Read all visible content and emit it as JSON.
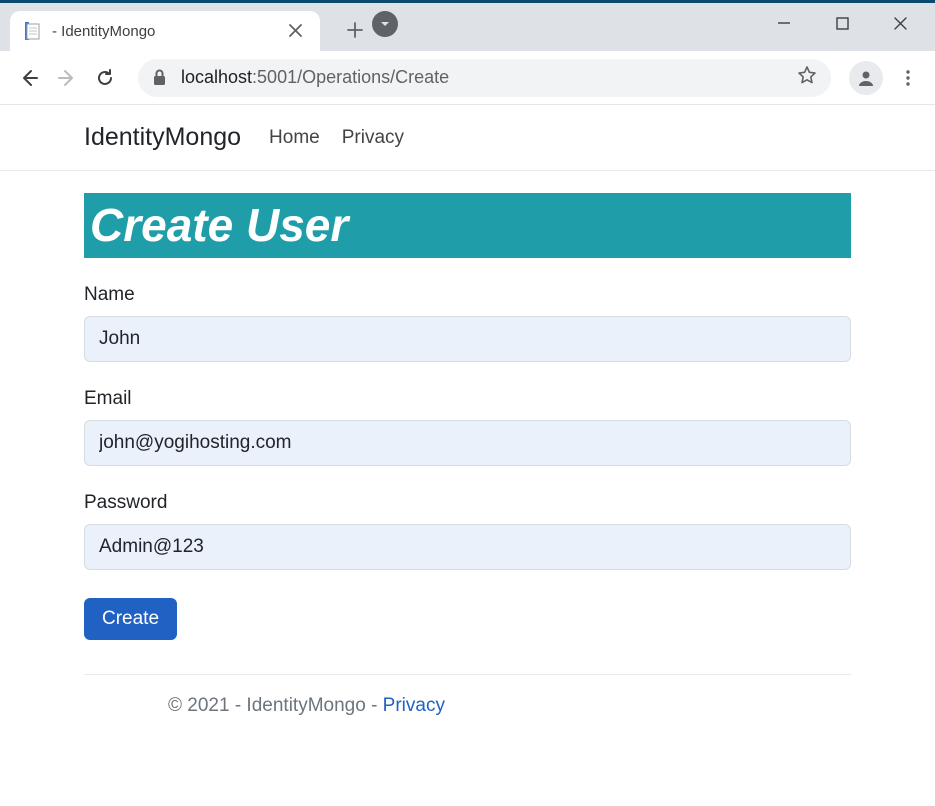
{
  "browser": {
    "tab_title": " - IdentityMongo",
    "url_host": "localhost",
    "url_port_path": ":5001/Operations/Create"
  },
  "nav": {
    "brand": "IdentityMongo",
    "links": [
      "Home",
      "Privacy"
    ]
  },
  "page": {
    "title": "Create User"
  },
  "form": {
    "name": {
      "label": "Name",
      "value": "John"
    },
    "email": {
      "label": "Email",
      "value": "john@yogihosting.com"
    },
    "password": {
      "label": "Password",
      "value": "Admin@123"
    },
    "submit_label": "Create"
  },
  "footer": {
    "text": "© 2021 - IdentityMongo - ",
    "link": "Privacy"
  }
}
